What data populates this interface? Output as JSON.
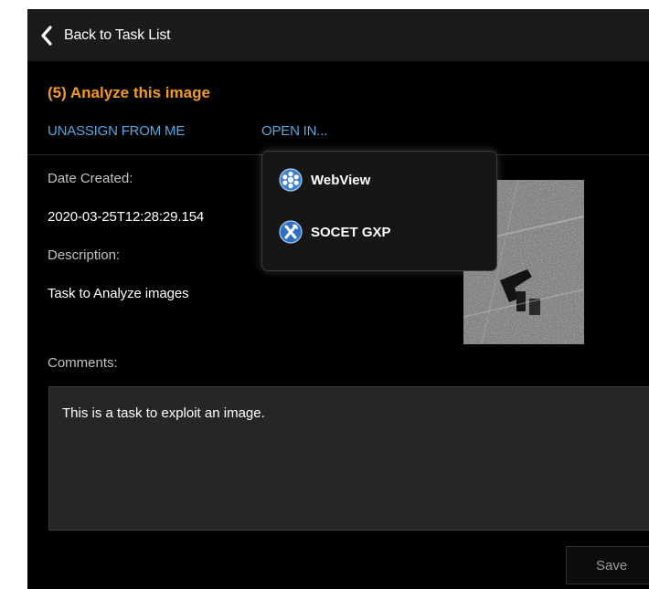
{
  "header": {
    "back_label": "Back to Task List"
  },
  "task": {
    "title": "(5) Analyze this image",
    "actions": {
      "unassign": "UNASSIGN FROM ME",
      "open_in": "OPEN IN..."
    }
  },
  "details": {
    "date_created_label": "Date Created:",
    "date_created_value": "2020-03-25T12:28:29.154",
    "description_label": "Description:",
    "description_value": "Task to Analyze images",
    "comments_label": "Comments:",
    "comments_value": "This is a task to exploit an image."
  },
  "buttons": {
    "save": "Save"
  },
  "open_in_menu": {
    "items": [
      {
        "label": "WebView",
        "icon": "webview-icon"
      },
      {
        "label": "SOCET GXP",
        "icon": "socet-gxp-icon"
      }
    ]
  },
  "colors": {
    "title": "#f39a1f",
    "link": "#5aa7e0",
    "background": "#000000",
    "topbar": "#1b1b1b"
  }
}
